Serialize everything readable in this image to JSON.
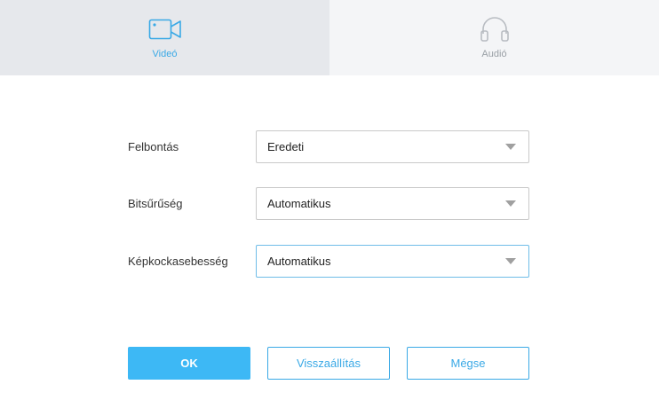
{
  "tabs": [
    {
      "label": "Videó",
      "icon": "video-camera-icon",
      "active": true
    },
    {
      "label": "Audió",
      "icon": "headphones-icon",
      "active": false
    }
  ],
  "form": {
    "resolution": {
      "label": "Felbontás",
      "value": "Eredeti"
    },
    "bitrate": {
      "label": "Bitsűrűség",
      "value": "Automatikus"
    },
    "framerate": {
      "label": "Képkockasebesség",
      "value": "Automatikus"
    }
  },
  "buttons": {
    "ok": "OK",
    "reset": "Visszaállítás",
    "cancel": "Mégse"
  },
  "colors": {
    "accent": "#3aa9e6",
    "primary_button": "#3db8f5",
    "active_tab_bg": "#e6e8ec",
    "inactive_tab_bg": "#f4f5f7"
  }
}
